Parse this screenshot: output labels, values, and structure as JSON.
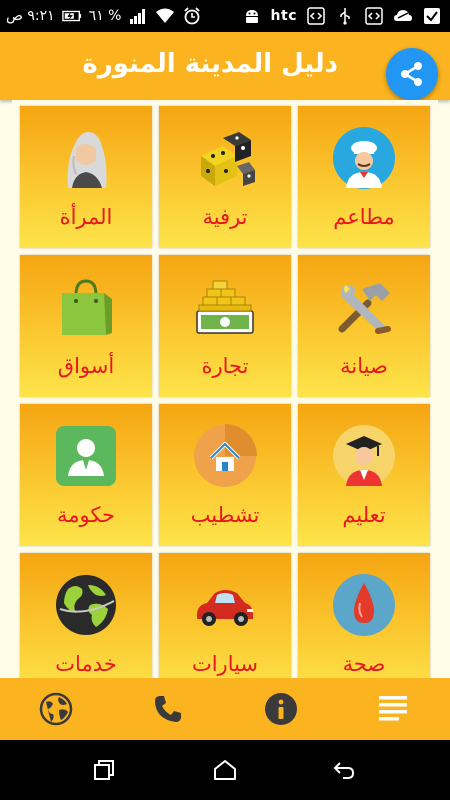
{
  "status_bar": {
    "time": "٩:٢١ ص",
    "battery": "٦١ %",
    "carrier": "htc",
    "icons": [
      "battery-icon",
      "signal-icon",
      "wifi-icon",
      "alarm-icon",
      "android-icon",
      "htc-icon",
      "code-icon",
      "usb-icon",
      "code-icon",
      "cloud-icon",
      "check-icon"
    ]
  },
  "app_bar": {
    "title": "دليل المدينة المنورة",
    "share_icon": "share-icon"
  },
  "tiles": [
    {
      "label": "مطاعم",
      "icon": "chef-icon"
    },
    {
      "label": "ترفية",
      "icon": "dice-icon"
    },
    {
      "label": "المرأة",
      "icon": "woman-icon"
    },
    {
      "label": "صيانة",
      "icon": "tools-icon"
    },
    {
      "label": "تجارة",
      "icon": "money-icon"
    },
    {
      "label": "أسواق",
      "icon": "shopping-bag-icon"
    },
    {
      "label": "تعليم",
      "icon": "graduate-icon"
    },
    {
      "label": "تشطيب",
      "icon": "home-icon"
    },
    {
      "label": "حكومة",
      "icon": "government-icon"
    },
    {
      "label": "صحة",
      "icon": "blood-drop-icon"
    },
    {
      "label": "سيارات",
      "icon": "car-icon"
    },
    {
      "label": "خدمات",
      "icon": "globe-icon"
    }
  ],
  "bottom_bar": [
    "globe-icon",
    "phone-icon",
    "info-icon",
    "menu-icon"
  ],
  "nav_bar": [
    "recent-apps-icon",
    "home-icon",
    "back-icon"
  ],
  "colors": {
    "accent": "#fbb31f",
    "label": "#e8171d",
    "fab": "#2196f3"
  }
}
